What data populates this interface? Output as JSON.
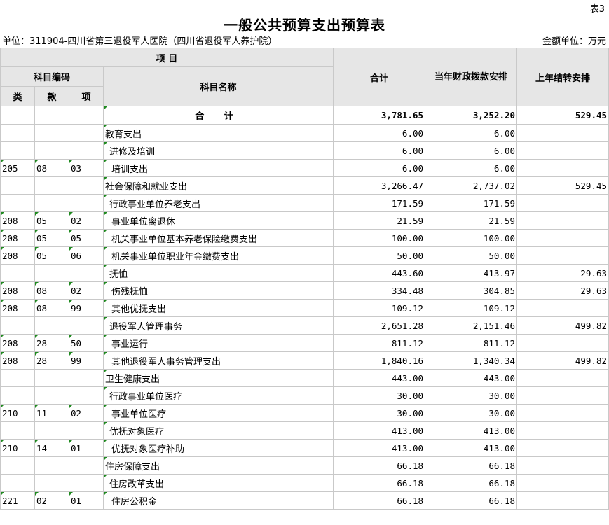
{
  "doc": {
    "tag": "表3",
    "title": "一般公共预算支出预算表",
    "unit_left": "单位：311904-四川省第三退役军人医院（四川省退役军人养护院）",
    "unit_right": "金额单位：万元"
  },
  "header": {
    "project": "项  目",
    "code": "科目编码",
    "lei": "类",
    "kuan": "款",
    "xiang": "项",
    "name": "科目名称",
    "total": "合计",
    "current": "当年财政拨款安排",
    "carryover": "上年结转安排"
  },
  "total_row": {
    "label": "合  计",
    "total": "3,781.65",
    "current": "3,252.20",
    "carryover": "529.45"
  },
  "rows": [
    {
      "lei": "",
      "kuan": "",
      "xiang": "",
      "name": "教育支出",
      "total": "6.00",
      "current": "6.00",
      "carryover": "",
      "level": 1
    },
    {
      "lei": "",
      "kuan": "",
      "xiang": "",
      "name": "进修及培训",
      "total": "6.00",
      "current": "6.00",
      "carryover": "",
      "level": 2
    },
    {
      "lei": "205",
      "kuan": "08",
      "xiang": "03",
      "name": "培训支出",
      "total": "6.00",
      "current": "6.00",
      "carryover": "",
      "level": 3
    },
    {
      "lei": "",
      "kuan": "",
      "xiang": "",
      "name": "社会保障和就业支出",
      "total": "3,266.47",
      "current": "2,737.02",
      "carryover": "529.45",
      "level": 1
    },
    {
      "lei": "",
      "kuan": "",
      "xiang": "",
      "name": "行政事业单位养老支出",
      "total": "171.59",
      "current": "171.59",
      "carryover": "",
      "level": 2
    },
    {
      "lei": "208",
      "kuan": "05",
      "xiang": "02",
      "name": "事业单位离退休",
      "total": "21.59",
      "current": "21.59",
      "carryover": "",
      "level": 3
    },
    {
      "lei": "208",
      "kuan": "05",
      "xiang": "05",
      "name": "机关事业单位基本养老保险缴费支出",
      "total": "100.00",
      "current": "100.00",
      "carryover": "",
      "level": 3
    },
    {
      "lei": "208",
      "kuan": "05",
      "xiang": "06",
      "name": "机关事业单位职业年金缴费支出",
      "total": "50.00",
      "current": "50.00",
      "carryover": "",
      "level": 3
    },
    {
      "lei": "",
      "kuan": "",
      "xiang": "",
      "name": "抚恤",
      "total": "443.60",
      "current": "413.97",
      "carryover": "29.63",
      "level": 2
    },
    {
      "lei": "208",
      "kuan": "08",
      "xiang": "02",
      "name": "伤残抚恤",
      "total": "334.48",
      "current": "304.85",
      "carryover": "29.63",
      "level": 3
    },
    {
      "lei": "208",
      "kuan": "08",
      "xiang": "99",
      "name": "其他优抚支出",
      "total": "109.12",
      "current": "109.12",
      "carryover": "",
      "level": 3
    },
    {
      "lei": "",
      "kuan": "",
      "xiang": "",
      "name": "退役军人管理事务",
      "total": "2,651.28",
      "current": "2,151.46",
      "carryover": "499.82",
      "level": 2
    },
    {
      "lei": "208",
      "kuan": "28",
      "xiang": "50",
      "name": "事业运行",
      "total": "811.12",
      "current": "811.12",
      "carryover": "",
      "level": 3
    },
    {
      "lei": "208",
      "kuan": "28",
      "xiang": "99",
      "name": "其他退役军人事务管理支出",
      "total": "1,840.16",
      "current": "1,340.34",
      "carryover": "499.82",
      "level": 3
    },
    {
      "lei": "",
      "kuan": "",
      "xiang": "",
      "name": "卫生健康支出",
      "total": "443.00",
      "current": "443.00",
      "carryover": "",
      "level": 1
    },
    {
      "lei": "",
      "kuan": "",
      "xiang": "",
      "name": "行政事业单位医疗",
      "total": "30.00",
      "current": "30.00",
      "carryover": "",
      "level": 2
    },
    {
      "lei": "210",
      "kuan": "11",
      "xiang": "02",
      "name": "事业单位医疗",
      "total": "30.00",
      "current": "30.00",
      "carryover": "",
      "level": 3
    },
    {
      "lei": "",
      "kuan": "",
      "xiang": "",
      "name": "优抚对象医疗",
      "total": "413.00",
      "current": "413.00",
      "carryover": "",
      "level": 2
    },
    {
      "lei": "210",
      "kuan": "14",
      "xiang": "01",
      "name": "优抚对象医疗补助",
      "total": "413.00",
      "current": "413.00",
      "carryover": "",
      "level": 3
    },
    {
      "lei": "",
      "kuan": "",
      "xiang": "",
      "name": "住房保障支出",
      "total": "66.18",
      "current": "66.18",
      "carryover": "",
      "level": 1
    },
    {
      "lei": "",
      "kuan": "",
      "xiang": "",
      "name": "住房改革支出",
      "total": "66.18",
      "current": "66.18",
      "carryover": "",
      "level": 2
    },
    {
      "lei": "221",
      "kuan": "02",
      "xiang": "01",
      "name": "住房公积金",
      "total": "66.18",
      "current": "66.18",
      "carryover": "",
      "level": 3
    }
  ]
}
